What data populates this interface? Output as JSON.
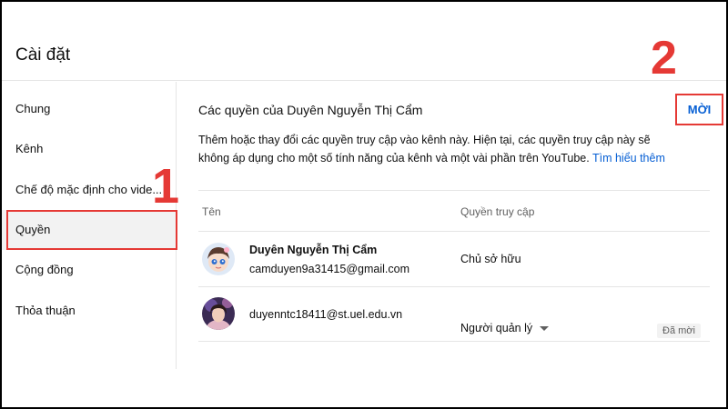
{
  "header": {
    "title": "Cài đặt"
  },
  "sidebar": {
    "items": [
      {
        "label": "Chung"
      },
      {
        "label": "Kênh"
      },
      {
        "label": "Chế độ mặc định cho vide..."
      },
      {
        "label": "Quyền"
      },
      {
        "label": "Cộng đồng"
      },
      {
        "label": "Thỏa thuận"
      }
    ],
    "active_index": 3
  },
  "main": {
    "title": "Các quyền của Duyên Nguyễn Thị Cẩm",
    "invite_label": "MỜI",
    "description": "Thêm hoặc thay đổi các quyền truy cập vào kênh này. Hiện tại, các quyền truy cập này sẽ không áp dụng cho một số tính năng của kênh và một vài phần trên YouTube.",
    "learn_more": "Tìm hiểu thêm",
    "columns": {
      "name": "Tên",
      "access": "Quyền truy cập"
    },
    "rows": [
      {
        "name": "Duyên Nguyễn Thị Cẩm",
        "email": "camduyen9a31415@gmail.com",
        "role": "Chủ sở hữu"
      },
      {
        "email": "duyenntc18411@st.uel.edu.vn",
        "role": "Người quản lý",
        "status": "Đã mời"
      }
    ]
  },
  "annotations": {
    "step1": "1",
    "step2": "2"
  },
  "colors": {
    "accent": "#065fd4",
    "highlight": "#e53935"
  },
  "icons": {
    "dropdown": "chevron-down-icon"
  }
}
